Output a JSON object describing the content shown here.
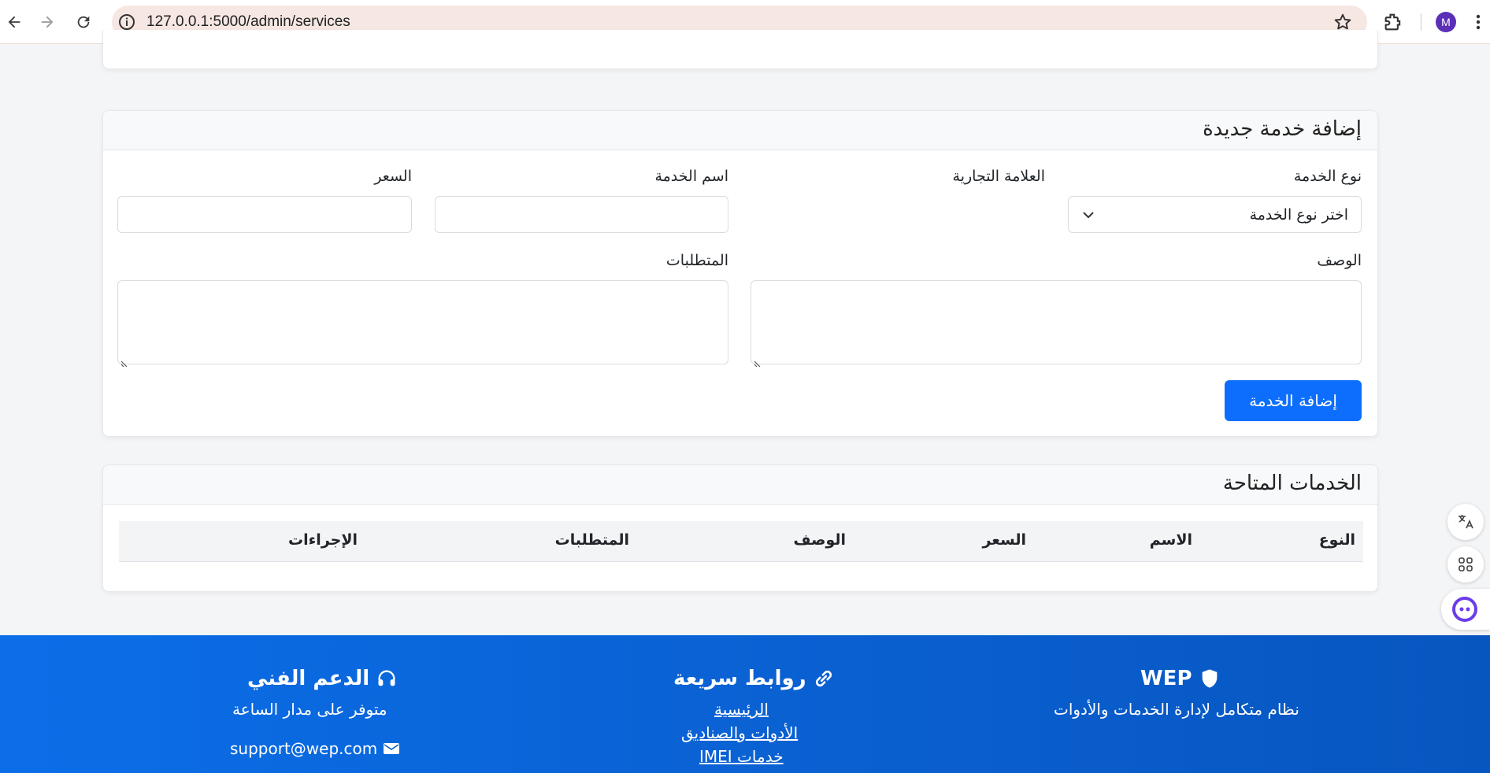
{
  "browser": {
    "url": "127.0.0.1:5000/admin/services",
    "avatar_letter": "M"
  },
  "add_service": {
    "title": "إضافة خدمة جديدة",
    "labels": {
      "service_type": "نوع الخدمة",
      "brand": "العلامة التجارية",
      "service_name": "اسم الخدمة",
      "price": "السعر",
      "description": "الوصف",
      "requirements": "المتطلبات"
    },
    "service_type_selected": "اختر نوع الخدمة",
    "service_name_value": "",
    "price_value": "",
    "description_value": "",
    "requirements_value": "",
    "submit_label": "إضافة الخدمة",
    "accent": "#0d6efd"
  },
  "services_list": {
    "title": "الخدمات المتاحة",
    "columns": [
      "النوع",
      "الاسم",
      "السعر",
      "الوصف",
      "المتطلبات",
      "الإجراءات"
    ]
  },
  "footer": {
    "brand": {
      "title": "WEP",
      "tagline": "نظام متكامل لإدارة الخدمات والأدوات"
    },
    "quick_links": {
      "title": "روابط سريعة",
      "links": [
        "الرئيسية",
        "الأدوات والصناديق",
        "خدمات IMEI"
      ]
    },
    "support": {
      "title": "الدعم الفني",
      "availability": "متوفر على مدار الساعة",
      "email": "support@wep.com"
    },
    "bg_color": "#0b6ee8"
  }
}
